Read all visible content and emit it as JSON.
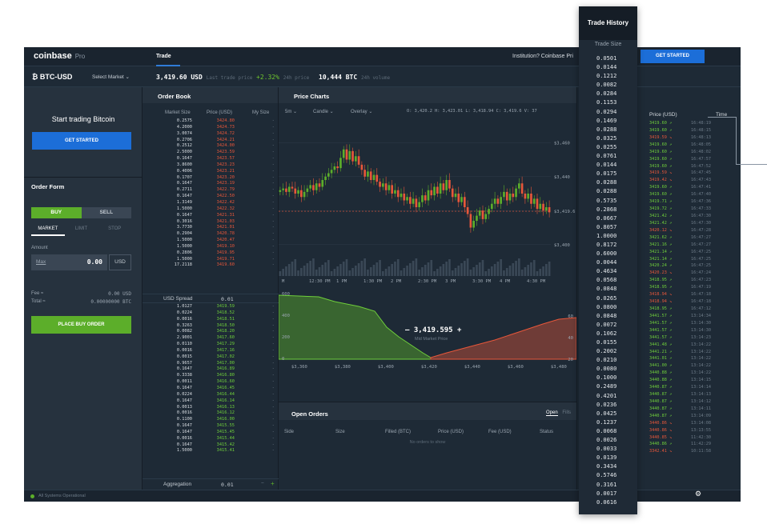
{
  "header": {
    "logo": "coinbase",
    "logo_sub": "Pro",
    "nav_trade": "Trade",
    "institution": "Institution? Coinbase Pri",
    "get_started": "GET STARTED"
  },
  "stats": {
    "pair": "BTC-USD",
    "select_market": "Select Market ⌄",
    "price": "3,419.60 USD",
    "price_lbl": "Last trade price",
    "change": "+2.32%",
    "change_lbl": "24h price",
    "volume": "10,444 BTC",
    "volume_lbl": "24h volume"
  },
  "left": {
    "start_title": "Start trading Bitcoin",
    "get_started": "GET STARTED",
    "order_form": "Order Form",
    "buy": "BUY",
    "sell": "SELL",
    "market": "MARKET",
    "limit": "LIMIT",
    "stop": "STOP",
    "amount_lbl": "Amount",
    "max": "Max",
    "amount_val": "0.00",
    "usd": "USD",
    "fee_lbl": "Fee ≈",
    "fee_val": "0.00 USD",
    "total_lbl": "Total ≈",
    "total_val": "0.00000000 BTC",
    "place_order": "PLACE BUY ORDER",
    "system_status": "All Systems Operational"
  },
  "orderbook": {
    "title": "Order Book",
    "col_size": "Market Size",
    "col_price": "Price (USD)",
    "col_my": "My Size",
    "asks": [
      {
        "s": "0.2575",
        "p": "3424.80"
      },
      {
        "s": "4.2000",
        "p": "3424.73"
      },
      {
        "s": "3.0074",
        "p": "3424.72"
      },
      {
        "s": "0.2706",
        "p": "3424.21"
      },
      {
        "s": "0.2512",
        "p": "3424.00"
      },
      {
        "s": "2.5000",
        "p": "3423.59"
      },
      {
        "s": "0.1647",
        "p": "3423.57"
      },
      {
        "s": "3.8600",
        "p": "3423.23"
      },
      {
        "s": "0.4006",
        "p": "3423.21"
      },
      {
        "s": "0.1707",
        "p": "3423.20"
      },
      {
        "s": "0.1647",
        "p": "3423.19"
      },
      {
        "s": "0.2711",
        "p": "3422.79"
      },
      {
        "s": "0.1647",
        "p": "3422.50"
      },
      {
        "s": "1.3149",
        "p": "3422.42"
      },
      {
        "s": "1.5000",
        "p": "3422.32"
      },
      {
        "s": "0.1647",
        "p": "3421.31"
      },
      {
        "s": "0.3016",
        "p": "3421.03"
      },
      {
        "s": "3.7730",
        "p": "3421.01"
      },
      {
        "s": "0.2904",
        "p": "3420.78"
      },
      {
        "s": "1.5000",
        "p": "3420.47"
      },
      {
        "s": "1.5000",
        "p": "3419.10"
      },
      {
        "s": "0.2806",
        "p": "3419.95"
      },
      {
        "s": "1.5000",
        "p": "3419.71"
      },
      {
        "s": "17.2118",
        "p": "3419.60"
      }
    ],
    "spread_lbl": "USD Spread",
    "spread_val": "0.01",
    "bids": [
      {
        "s": "1.0127",
        "p": "3419.59"
      },
      {
        "s": "0.0224",
        "p": "3418.52"
      },
      {
        "s": "0.0016",
        "p": "3418.51"
      },
      {
        "s": "0.3263",
        "p": "3418.50"
      },
      {
        "s": "0.0082",
        "p": "3418.20"
      },
      {
        "s": "2.9001",
        "p": "3417.60"
      },
      {
        "s": "0.0110",
        "p": "3417.29"
      },
      {
        "s": "0.0016",
        "p": "3417.16"
      },
      {
        "s": "0.0015",
        "p": "3417.02"
      },
      {
        "s": "0.9657",
        "p": "3417.00"
      },
      {
        "s": "0.1647",
        "p": "3416.89"
      },
      {
        "s": "0.3338",
        "p": "3416.80"
      },
      {
        "s": "0.0011",
        "p": "3416.60"
      },
      {
        "s": "0.1647",
        "p": "3416.45"
      },
      {
        "s": "0.0224",
        "p": "3416.44"
      },
      {
        "s": "0.1647",
        "p": "3416.14"
      },
      {
        "s": "0.0013",
        "p": "3416.13"
      },
      {
        "s": "0.0016",
        "p": "3416.12"
      },
      {
        "s": "0.1100",
        "p": "3416.00"
      },
      {
        "s": "0.1647",
        "p": "3415.55"
      },
      {
        "s": "0.1647",
        "p": "3415.45"
      },
      {
        "s": "0.0016",
        "p": "3415.44"
      },
      {
        "s": "0.1647",
        "p": "3415.42"
      },
      {
        "s": "1.5000",
        "p": "3415.41"
      }
    ],
    "agg_lbl": "Aggregation",
    "agg_val": "0.01",
    "agg_minus": "−",
    "agg_plus": "+"
  },
  "charts": {
    "title": "Price Charts",
    "interval": "5m ⌄",
    "type": "Candle ⌄",
    "overlay": "Overlay ⌄",
    "ohlc": "O: 3,420.2  H: 3,423.01  L: 3,418.94  C: 3,419.6  V: 37",
    "price_ticks": [
      "$3,460",
      "$3,440",
      "$3,419.6",
      "$3,400"
    ],
    "time_ticks": [
      "M",
      "12:30 PM",
      "1 PM",
      "1:30 PM",
      "2 PM",
      "2:30 PM",
      "3 PM",
      "3:30 PM",
      "4 PM",
      "4:30 PM"
    ],
    "mid_price": "— 3,419.595 +",
    "mid_lbl": "Mid Market Price",
    "depth_y_left": [
      "600",
      "400",
      "200",
      "0"
    ],
    "depth_y_right": [
      "60",
      "40",
      "20"
    ],
    "depth_x": [
      "$3,360",
      "$3,380",
      "$3,400",
      "$3,420",
      "$3,440",
      "$3,460",
      "$3,480"
    ]
  },
  "open_orders": {
    "title": "Open Orders",
    "tab_open": "Open",
    "tab_fills": "Fills",
    "cols": [
      "Side",
      "Size",
      "Filled (BTC)",
      "Price (USD)",
      "Fee (USD)",
      "Status"
    ],
    "empty": "No orders to show"
  },
  "trade_history": {
    "col_price": "Price (USD)",
    "col_time": "Time",
    "rows": [
      {
        "p": "3419.60 ↗",
        "t": "16:48:19",
        "c": "g"
      },
      {
        "p": "3419.60 ↗",
        "t": "16:48:15",
        "c": "g"
      },
      {
        "p": "3419.59 ↘",
        "t": "16:48:13",
        "c": "r"
      },
      {
        "p": "3419.60 ↗",
        "t": "16:48:05",
        "c": "g"
      },
      {
        "p": "3419.60 ↗",
        "t": "16:48:02",
        "c": "g"
      },
      {
        "p": "3419.60 ↗",
        "t": "16:47:57",
        "c": "g"
      },
      {
        "p": "3419.60 ↗",
        "t": "16:47:52",
        "c": "g"
      },
      {
        "p": "3419.59 ↘",
        "t": "16:47:45",
        "c": "r"
      },
      {
        "p": "3419.42 ↘",
        "t": "16:47:43",
        "c": "r"
      },
      {
        "p": "3419.60 ↗",
        "t": "16:47:41",
        "c": "g"
      },
      {
        "p": "3419.60 ↗",
        "t": "16:47:40",
        "c": "g"
      },
      {
        "p": "3419.71 ↗",
        "t": "16:47:36",
        "c": "g"
      },
      {
        "p": "3419.72 ↗",
        "t": "16:47:33",
        "c": "g"
      },
      {
        "p": "3421.42 ↗",
        "t": "16:47:30",
        "c": "g"
      },
      {
        "p": "3421.42 ↗",
        "t": "16:47:30",
        "c": "g"
      },
      {
        "p": "3420.12 ↘",
        "t": "16:47:28",
        "c": "r"
      },
      {
        "p": "3421.62 ↗",
        "t": "16:47:27",
        "c": "g"
      },
      {
        "p": "3421.16 ↗",
        "t": "16:47:27",
        "c": "g"
      },
      {
        "p": "3421.14 ↗",
        "t": "16:47:25",
        "c": "g"
      },
      {
        "p": "3421.14 ↗",
        "t": "16:47:25",
        "c": "g"
      },
      {
        "p": "3420.24 ↗",
        "t": "16:47:25",
        "c": "g"
      },
      {
        "p": "3420.23 ↘",
        "t": "16:47:24",
        "c": "r"
      },
      {
        "p": "3418.95 ↗",
        "t": "16:47:23",
        "c": "g"
      },
      {
        "p": "3418.95 ↗",
        "t": "16:47:19",
        "c": "g"
      },
      {
        "p": "3418.94 ↘",
        "t": "16:47:18",
        "c": "r"
      },
      {
        "p": "3418.94 ↘",
        "t": "16:47:18",
        "c": "r"
      },
      {
        "p": "3418.95 ↗",
        "t": "16:47:12",
        "c": "g"
      },
      {
        "p": "3441.57 ↗",
        "t": "13:14:34",
        "c": "g"
      },
      {
        "p": "3441.57 ↗",
        "t": "13:14:30",
        "c": "g"
      },
      {
        "p": "3441.57 ↗",
        "t": "13:14:30",
        "c": "g"
      },
      {
        "p": "3441.57 ↗",
        "t": "13:14:23",
        "c": "g"
      },
      {
        "p": "3441.48 ↗",
        "t": "13:14:22",
        "c": "g"
      },
      {
        "p": "3441.21 ↗",
        "t": "13:14:22",
        "c": "g"
      },
      {
        "p": "3441.01 ↗",
        "t": "13:14:22",
        "c": "g"
      },
      {
        "p": "3441.00 ↗",
        "t": "13:14:22",
        "c": "g"
      },
      {
        "p": "3440.88 ↗",
        "t": "13:14:22",
        "c": "g"
      },
      {
        "p": "3440.88 ↗",
        "t": "13:14:15",
        "c": "g"
      },
      {
        "p": "3440.87 ↗",
        "t": "13:14:14",
        "c": "g"
      },
      {
        "p": "3440.87 ↗",
        "t": "13:14:13",
        "c": "g"
      },
      {
        "p": "3440.87 ↗",
        "t": "13:14:12",
        "c": "g"
      },
      {
        "p": "3440.87 ↗",
        "t": "13:14:11",
        "c": "g"
      },
      {
        "p": "3440.87 ↗",
        "t": "13:14:09",
        "c": "g"
      },
      {
        "p": "3440.86 ↘",
        "t": "13:14:08",
        "c": "r"
      },
      {
        "p": "3440.86 ↘",
        "t": "13:13:55",
        "c": "r"
      },
      {
        "p": "3440.85 ↘",
        "t": "11:42:30",
        "c": "r"
      },
      {
        "p": "3440.86 ↗",
        "t": "11:42:29",
        "c": "g"
      },
      {
        "p": "3342.41 ↘",
        "t": "10:11:58",
        "c": "r"
      }
    ]
  },
  "overlay": {
    "title": "Trade History",
    "subtitle": "Trade Size",
    "sizes": [
      "0.0501",
      "0.0144",
      "0.1212",
      "0.0082",
      "0.0284",
      "0.1153",
      "0.0294",
      "0.1469",
      "0.0288",
      "0.0325",
      "0.0255",
      "0.0761",
      "0.0144",
      "0.0175",
      "0.0288",
      "0.0288",
      "0.5735",
      "0.2868",
      "0.0667",
      "0.8057",
      "1.0000",
      "0.8172",
      "0.6000",
      "0.0044",
      "0.4634",
      "0.0568",
      "0.0848",
      "0.0265",
      "0.0800",
      "0.0848",
      "0.0072",
      "0.1062",
      "0.0155",
      "0.2002",
      "0.0210",
      "0.0080",
      "0.1000",
      "0.2489",
      "0.4201",
      "0.0236",
      "0.0425",
      "0.1237",
      "0.0068",
      "0.0026",
      "0.0033",
      "0.0139",
      "0.3434",
      "0.5746",
      "0.3161",
      "0.0017",
      "0.0616"
    ]
  },
  "colors": {
    "accent": "#1c6ed8",
    "buy": "#5cae2a",
    "sell": "#e8573a",
    "bg": "#1e2a36"
  }
}
